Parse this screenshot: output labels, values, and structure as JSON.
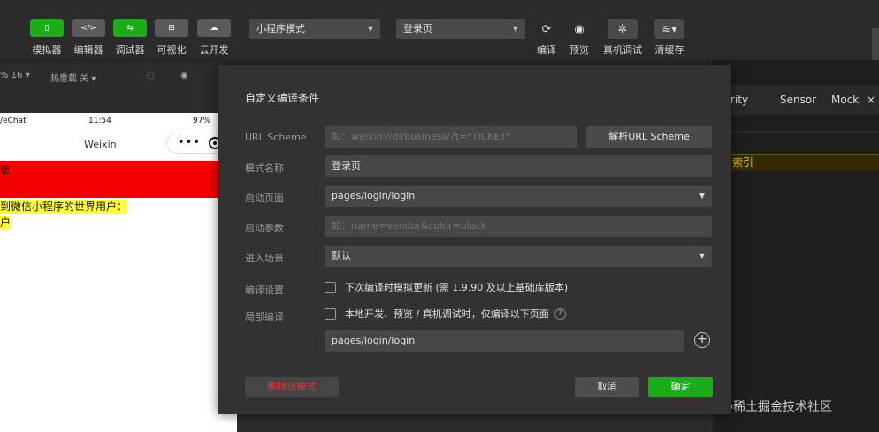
{
  "toolbar": {
    "buttons": [
      {
        "label": "模拟器",
        "glyph": "▯"
      },
      {
        "label": "编辑器",
        "glyph": "</>"
      },
      {
        "label": "调试器",
        "glyph": "⇆"
      },
      {
        "label": "可视化",
        "glyph": "⊞"
      },
      {
        "label": "云开发",
        "glyph": "☁"
      }
    ],
    "mode_select": "小程序模式",
    "page_select": "登录页",
    "compile_label": "编译",
    "preview_label": "预览",
    "remote_debug_label": "真机调试",
    "clear_cache_label": "清缓存"
  },
  "simbar": {
    "zoom": "% 16 ▾",
    "hot_reload": "热重载 关 ▾"
  },
  "phone": {
    "carrier": "/eChat",
    "time": "11:54",
    "battery": "97%",
    "nav_title": "Weixin",
    "capsule_dots": "•••",
    "red_text": "题",
    "line1": "到微信小程序的世界用户：",
    "line2": "户"
  },
  "devtools": {
    "tab_partial": "rity",
    "tab_sensor": "Sensor",
    "tab_mock": "Mock",
    "tab_close": "×",
    "warn_text": "索引"
  },
  "watermark": "@稀土掘金技术社区",
  "dialog": {
    "title": "自定义编译条件",
    "url_scheme_label": "URL Scheme",
    "url_scheme_placeholder": "如：weixin://dl/business/?t=*TICKET*",
    "parse_button": "解析URL Scheme",
    "mode_name_label": "模式名称",
    "mode_name_value": "登录页",
    "start_page_label": "启动页面",
    "start_page_value": "pages/login/login",
    "start_params_label": "启动参数",
    "start_params_placeholder": "如：name=vendor&color=black",
    "scene_label": "进入场景",
    "scene_value": "默认",
    "compile_settings_label": "编译设置",
    "compile_settings_check": "下次编译时模拟更新 (需 1.9.90 及以上基础库版本)",
    "partial_compile_label": "局部编译",
    "partial_compile_check": "本地开发、预览 / 真机调试时，仅编译以下页面",
    "help_icon": "?",
    "partial_page_value": "pages/login/login",
    "add_icon": "+",
    "delete_button": "删除该模式",
    "cancel_button": "取消",
    "ok_button": "确定"
  },
  "colors": {
    "accent_green": "#1aad19",
    "danger_red": "#e03a3a",
    "dialog_bg": "#323232"
  }
}
